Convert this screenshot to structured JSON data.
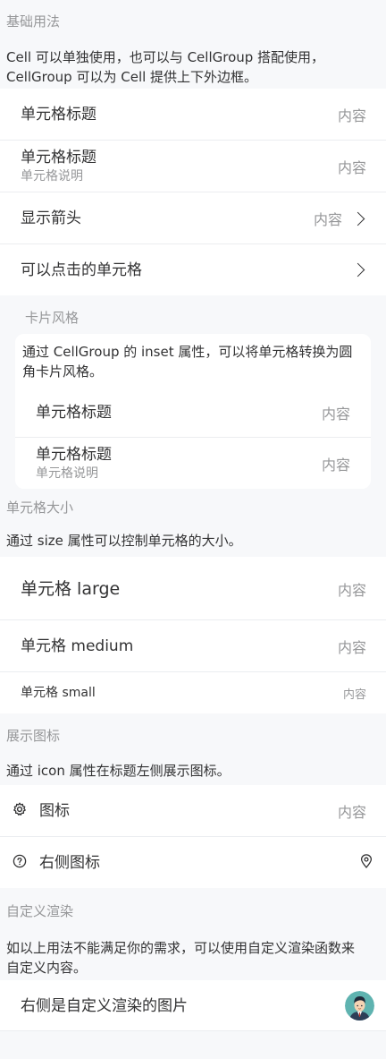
{
  "basic": {
    "title": "基础用法",
    "desc_line1": "Cell 可以单独使用，也可以与 CellGroup 搭配使用，",
    "desc_line2": "CellGroup 可以为 Cell 提供上下外边框。",
    "cells": [
      {
        "title": "单元格标题",
        "value": "内容"
      },
      {
        "title": "单元格标题",
        "label": "单元格说明",
        "value": "内容"
      },
      {
        "title": "显示箭头",
        "value": "内容"
      },
      {
        "title": "可以点击的单元格"
      }
    ]
  },
  "card": {
    "title": "卡片风格",
    "desc_line1": "通过 CellGroup 的 inset 属性，可以将单元格转换为圆",
    "desc_line2": "角卡片风格。",
    "cells": [
      {
        "title": "单元格标题",
        "value": "内容"
      },
      {
        "title": "单元格标题",
        "label": "单元格说明",
        "value": "内容"
      }
    ]
  },
  "size": {
    "title": "单元格大小",
    "desc": "通过 size 属性可以控制单元格的大小。",
    "cells": [
      {
        "title": "单元格 large",
        "value": "内容"
      },
      {
        "title": "单元格 medium",
        "value": "内容"
      },
      {
        "title": "单元格 small",
        "value": "内容"
      }
    ]
  },
  "icon": {
    "title": "展示图标",
    "desc": "通过 icon 属性在标题左侧展示图标。",
    "cells": [
      {
        "title": "图标",
        "value": "内容",
        "icon": "gear-icon"
      },
      {
        "title": "右侧图标",
        "icon": "question-circle-icon",
        "right_icon": "location-pin-icon"
      }
    ]
  },
  "custom": {
    "title": "自定义渲染",
    "desc_line1": "如以上用法不能满足你的需求，可以使用自定义渲染函数来",
    "desc_line2": "自定义内容。",
    "cells": [
      {
        "title": "右侧是自定义渲染的图片",
        "right": "avatar"
      }
    ]
  }
}
